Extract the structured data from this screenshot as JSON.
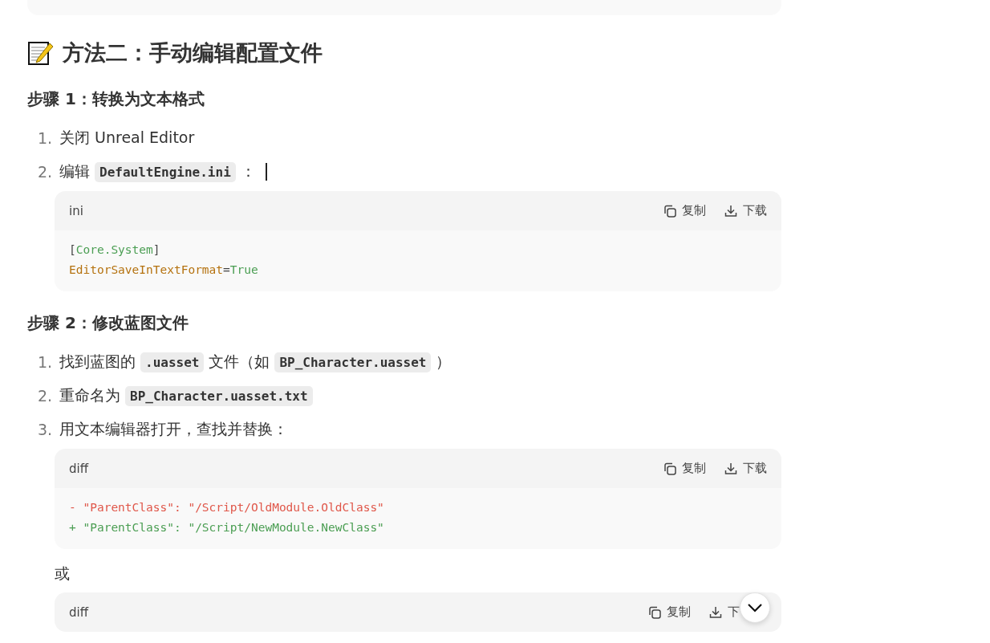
{
  "heading": {
    "text": "方法二：手动编辑配置文件"
  },
  "sections": [
    {
      "title": "步骤 1：转换为文本格式",
      "items": [
        {
          "number": "1.",
          "segments": [
            {
              "kind": "text",
              "text": "关闭 Unreal Editor"
            }
          ]
        },
        {
          "number": "2.",
          "segments": [
            {
              "kind": "text",
              "text": "编辑"
            },
            {
              "kind": "code",
              "text": "DefaultEngine.ini"
            },
            {
              "kind": "text",
              "text": "："
            }
          ],
          "cursor": true,
          "blocks": [
            {
              "kind": "code_block",
              "language": "ini",
              "copy": "复制",
              "download": "下载",
              "lines": [
                [
                  {
                    "kind": "punct",
                    "text": "["
                  },
                  {
                    "kind": "section",
                    "text": "Core.System"
                  },
                  {
                    "kind": "punct",
                    "text": "]"
                  }
                ],
                [
                  {
                    "kind": "key",
                    "text": "EditorSaveInTextFormat"
                  },
                  {
                    "kind": "punct",
                    "text": "="
                  },
                  {
                    "kind": "value",
                    "text": "True"
                  }
                ]
              ]
            }
          ]
        }
      ]
    },
    {
      "title": "步骤 2：修改蓝图文件",
      "items": [
        {
          "number": "1.",
          "segments": [
            {
              "kind": "text",
              "text": "找到蓝图的"
            },
            {
              "kind": "code",
              "text": ".uasset"
            },
            {
              "kind": "text",
              "text": "文件（如"
            },
            {
              "kind": "code",
              "text": "BP_Character.uasset"
            },
            {
              "kind": "text",
              "text": "）"
            }
          ]
        },
        {
          "number": "2.",
          "segments": [
            {
              "kind": "text",
              "text": "重命名为"
            },
            {
              "kind": "code",
              "text": "BP_Character.uasset.txt"
            }
          ]
        },
        {
          "number": "3.",
          "segments": [
            {
              "kind": "text",
              "text": "用文本编辑器打开，查找并替换："
            }
          ],
          "blocks": [
            {
              "kind": "code_block",
              "language": "diff",
              "copy": "复制",
              "download": "下载",
              "lines": [
                [
                  {
                    "kind": "removed",
                    "text": "- \"ParentClass\": \"/Script/OldModule.OldClass\""
                  }
                ],
                [
                  {
                    "kind": "added",
                    "text": "+ \"ParentClass\": \"/Script/NewModule.NewClass\""
                  }
                ]
              ]
            },
            {
              "kind": "paragraph",
              "text": "或"
            },
            {
              "kind": "code_block",
              "language": "diff",
              "copy": "复制",
              "download": "下"
            }
          ]
        }
      ]
    }
  ]
}
